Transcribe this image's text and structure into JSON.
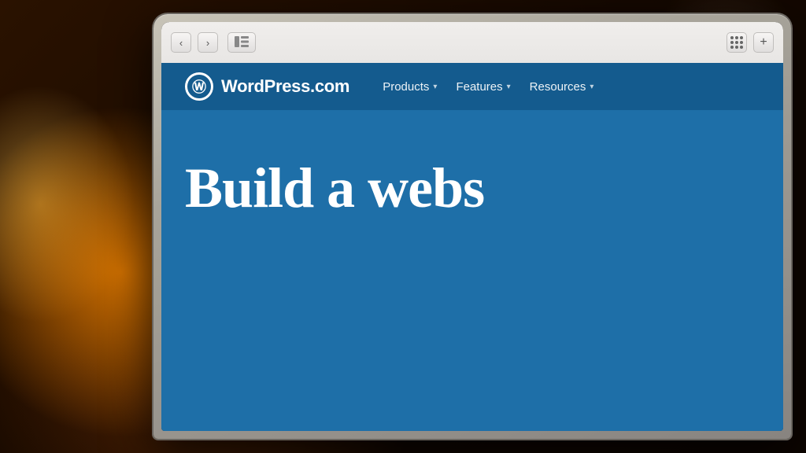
{
  "background": {
    "description": "Blurred bokeh background with warm orange light"
  },
  "browser": {
    "back_button_label": "‹",
    "forward_button_label": "›",
    "sidebar_button_label": "⊡",
    "plus_button_label": "+"
  },
  "website": {
    "logo_symbol": "W",
    "logo_text": "WordPress.com",
    "nav_items": [
      {
        "label": "Products",
        "has_dropdown": true
      },
      {
        "label": "Features",
        "has_dropdown": true
      },
      {
        "label": "Resources",
        "has_dropdown": true
      }
    ],
    "hero_text": "Build a webs"
  }
}
